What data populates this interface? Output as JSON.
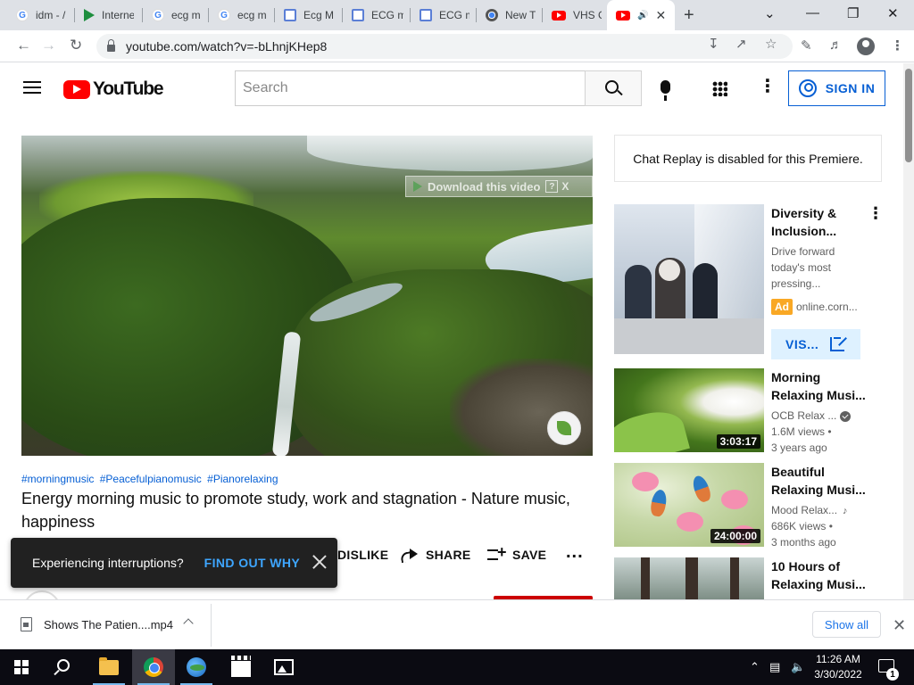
{
  "browser": {
    "tabs": [
      {
        "title": "idm - /",
        "icon": "google-icon"
      },
      {
        "title": "Interne",
        "icon": "play-icon"
      },
      {
        "title": "ecg m",
        "icon": "google-icon"
      },
      {
        "title": "ecg m",
        "icon": "google-icon"
      },
      {
        "title": "Ecg M",
        "icon": "doc-icon"
      },
      {
        "title": "ECG m",
        "icon": "doc-icon"
      },
      {
        "title": "ECG m",
        "icon": "doc-icon"
      },
      {
        "title": "New T",
        "icon": "chrome-icon"
      },
      {
        "title": "VHS G",
        "icon": "youtube-icon"
      },
      {
        "title": "",
        "icon": "youtube-icon",
        "active": true,
        "audio": true
      }
    ],
    "url": "youtube.com/watch?v=-bLhnjKHep8"
  },
  "youtube": {
    "logo_text": "YouTube",
    "search_placeholder": "Search",
    "sign_in": "SIGN IN",
    "player_overlay": {
      "download_text": "Download this video",
      "help": "?",
      "close": "X"
    },
    "hashtags": [
      "#morningmusic",
      "#Peacefulpianomusic",
      "#Pianorelaxing"
    ],
    "video_title": "Energy morning music to promote study, work and stagnation - Nature music, happiness",
    "actions": {
      "dislike": "DISLIKE",
      "share": "SHARE",
      "save": "SAVE",
      "more": "..."
    },
    "toast": {
      "message": "Experiencing interruptions?",
      "action": "FIND OUT WHY"
    },
    "chat_replay": "Chat Replay is disabled for this Premiere.",
    "ad": {
      "title": "Diversity & Inclusion...",
      "description": "Drive forward today's most pressing...",
      "badge": "Ad",
      "domain": "online.corn...",
      "visit": "VIS..."
    },
    "recommendations": [
      {
        "title": "Morning Relaxing Musi...",
        "channel": "OCB Relax ...",
        "verified": true,
        "views": "1.6M views •",
        "age": "3 years ago",
        "duration": "3:03:17"
      },
      {
        "title": "Beautiful Relaxing Musi...",
        "channel": "Mood Relax...",
        "music_note": true,
        "views": "686K views •",
        "age": "3 months ago",
        "duration": "24:00:00"
      },
      {
        "title": "10 Hours of Relaxing Musi...",
        "channel": "",
        "views": "",
        "age": "",
        "duration": ""
      }
    ]
  },
  "download_shelf": {
    "filename": "Shows The Patien....mp4",
    "show_all": "Show all"
  },
  "taskbar": {
    "time": "11:26 AM",
    "date": "3/30/2022",
    "notification_count": "1"
  }
}
